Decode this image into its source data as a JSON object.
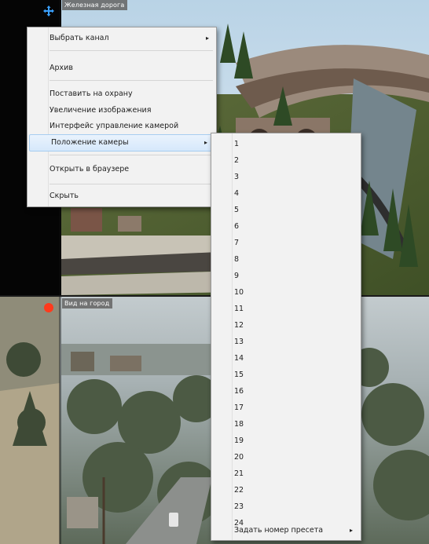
{
  "cameras": {
    "top": {
      "label": "Железная дорога"
    },
    "bottom": {
      "label": "Вид на город"
    }
  },
  "context_menu": {
    "items": [
      {
        "label": "Выбрать канал",
        "has_submenu": true
      },
      {
        "label": "Архив"
      },
      {
        "label": "Поставить на охрану"
      },
      {
        "label": "Увеличение изображения"
      },
      {
        "label": "Интерфейс управление камерой"
      },
      {
        "label": "Положение камеры",
        "has_submenu": true,
        "highlighted": true
      },
      {
        "label": "Открыть в браузере"
      },
      {
        "label": "Скрыть"
      }
    ]
  },
  "preset_submenu": {
    "presets": [
      "1",
      "2",
      "3",
      "4",
      "5",
      "6",
      "7",
      "8",
      "9",
      "10",
      "11",
      "12",
      "13",
      "14",
      "15",
      "16",
      "17",
      "18",
      "19",
      "20",
      "21",
      "22",
      "23",
      "24"
    ],
    "set_preset_label": "Задать номер пресета"
  },
  "icons": {
    "submenu_arrow": "▸"
  },
  "colors": {
    "highlight": "#d6e8fb",
    "record_dot": "#ff3a1c"
  }
}
